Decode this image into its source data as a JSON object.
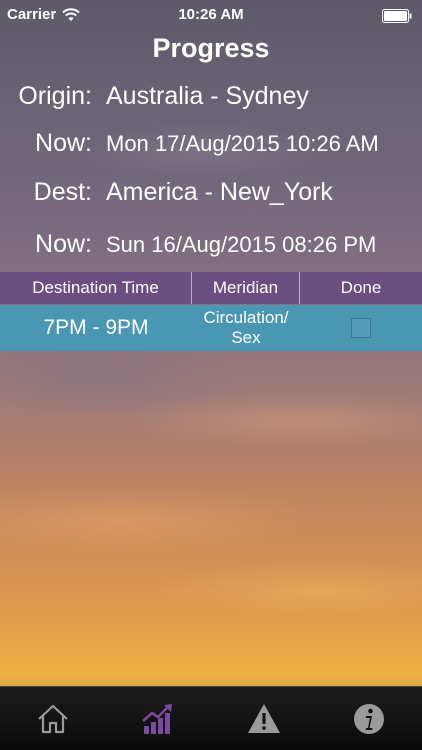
{
  "status_bar": {
    "carrier": "Carrier",
    "time": "10:26 AM"
  },
  "title": "Progress",
  "info": {
    "origin_label": "Origin:",
    "origin_value": "Australia - Sydney",
    "now1_label": "Now:",
    "now1_value": "Mon 17/Aug/2015 10:26 AM",
    "dest_label": "Dest:",
    "dest_value": "America - New_York",
    "now2_label": "Now:",
    "now2_value": "Sun 16/Aug/2015 08:26 PM"
  },
  "table": {
    "headers": [
      "Destination Time",
      "Meridian",
      "Done"
    ],
    "rows": [
      {
        "time": "7PM - 9PM",
        "meridian_line1": "Circulation/",
        "meridian_line2": "Sex",
        "done": false
      }
    ]
  },
  "tab_bar": {
    "icons": [
      "home-icon",
      "progress-chart-icon",
      "warning-icon",
      "info-icon"
    ],
    "active_index": 1
  },
  "colors": {
    "header_bg": "#6a4e80",
    "row_bg": "#4a97b4",
    "tab_active": "#7a4a9e",
    "tab_inactive": "#9a9a9a"
  }
}
